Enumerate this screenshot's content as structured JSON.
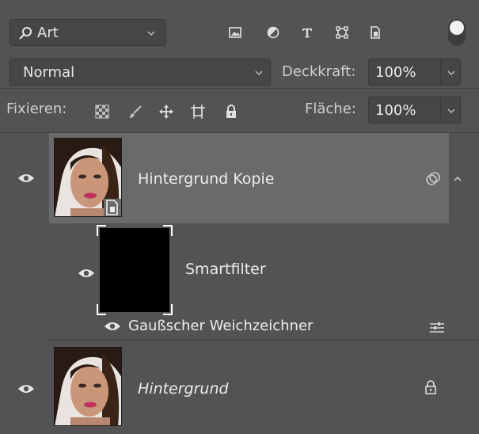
{
  "toolbar": {
    "filter_label": "Art",
    "filter_icons": [
      "image-filter-icon",
      "adjustment-filter-icon",
      "type-filter-icon",
      "shape-filter-icon",
      "smart-object-filter-icon"
    ],
    "filter_toggle": "on"
  },
  "blend": {
    "mode": "Normal",
    "opacity_label": "Deckkraft:",
    "opacity_value": "100%"
  },
  "lock": {
    "label": "Fixieren:",
    "icons": [
      "lock-transparent-pixels-icon",
      "lock-image-pixels-icon",
      "lock-position-icon",
      "lock-artboard-icon",
      "lock-all-icon"
    ],
    "fill_label": "Fläche:",
    "fill_value": "100%"
  },
  "layers": [
    {
      "name": "Hintergrund Kopie",
      "visible": true,
      "selected": true,
      "smart_object": true
    },
    {
      "name": "Smartfilter",
      "visible": true,
      "type": "smart-filter-mask"
    },
    {
      "name": "Gaußscher Weichzeichner",
      "visible": true,
      "type": "filter"
    },
    {
      "name": "Hintergrund",
      "visible": true,
      "locked": true,
      "italic": true
    }
  ],
  "colors": {
    "panel": "#535353",
    "selected_layer": "#6a6a6a",
    "field": "#464646"
  }
}
